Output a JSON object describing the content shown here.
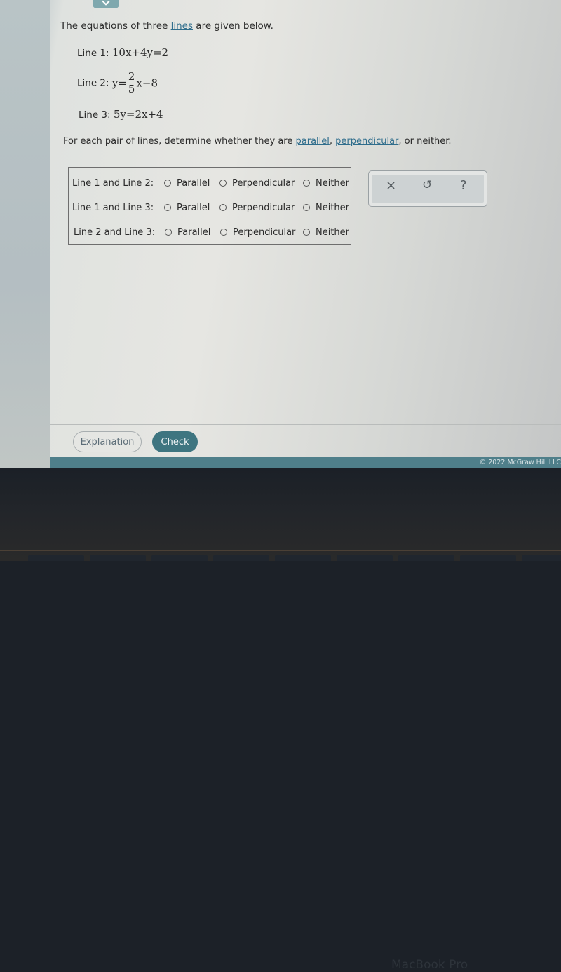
{
  "question": {
    "intro_before": "The equations of three ",
    "intro_link": "lines",
    "intro_after": " are given below.",
    "equations": [
      {
        "label": "Line 1: ",
        "math": "10x+4y=2"
      },
      {
        "label": "Line 2: ",
        "math_prefix": "y=",
        "frac_num": "2",
        "frac_den": "5",
        "math_suffix": "x−8"
      },
      {
        "label": "Line 3: ",
        "math": "5y=2x+4"
      }
    ],
    "instruction_before": "For each pair of lines, determine whether they are ",
    "instruction_link1": "parallel",
    "instruction_sep": ", ",
    "instruction_link2": "perpendicular",
    "instruction_after": ", or neither."
  },
  "answer_rows": [
    {
      "label": "Line 1 and Line 2:",
      "options": [
        "Parallel",
        "Perpendicular",
        "Neither"
      ],
      "selected": null
    },
    {
      "label": "Line 1 and Line 3:",
      "options": [
        "Parallel",
        "Perpendicular",
        "Neither"
      ],
      "selected": null
    },
    {
      "label": "Line 2 and Line 3:",
      "options": [
        "Parallel",
        "Perpendicular",
        "Neither"
      ],
      "selected": null
    }
  ],
  "tools": {
    "clear": "×",
    "undo": "↺",
    "help": "?"
  },
  "buttons": {
    "explanation": "Explanation",
    "check": "Check"
  },
  "footer": {
    "copyright": "© 2022 McGraw Hill LLC"
  },
  "device": {
    "label": "MacBook Pro"
  },
  "colors": {
    "accent": "#3e7580",
    "link": "#2f6d8c",
    "footer_bar": "#4f7f8a"
  }
}
